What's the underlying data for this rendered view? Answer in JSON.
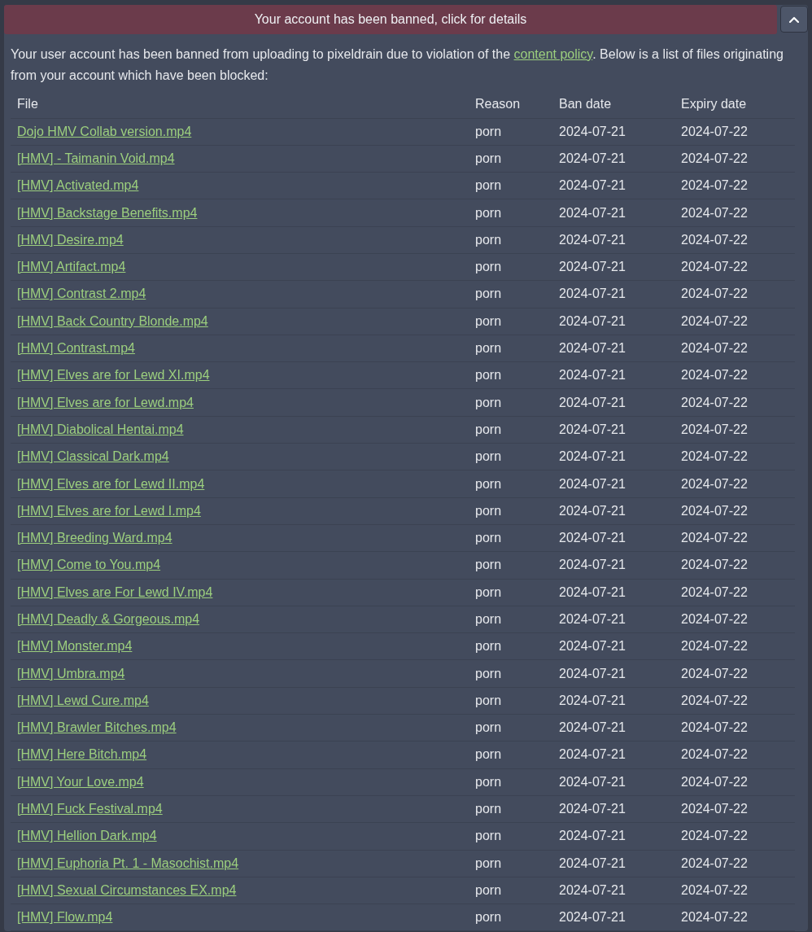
{
  "banner": {
    "text": "Your account has been banned, click for details",
    "expanded": true
  },
  "intro": {
    "before": "Your user account has been banned from uploading to pixeldrain due to violation of the ",
    "link": "content policy",
    "after": ". Below is a list of files originating from your account which have been blocked:"
  },
  "table": {
    "columns": [
      "File",
      "Reason",
      "Ban date",
      "Expiry date"
    ],
    "rows": [
      [
        "Dojo HMV Collab version.mp4",
        "porn",
        "2024-07-21",
        "2024-07-22"
      ],
      [
        "[HMV] - Taimanin Void.mp4",
        "porn",
        "2024-07-21",
        "2024-07-22"
      ],
      [
        "[HMV] Activated.mp4",
        "porn",
        "2024-07-21",
        "2024-07-22"
      ],
      [
        "[HMV] Backstage Benefits.mp4",
        "porn",
        "2024-07-21",
        "2024-07-22"
      ],
      [
        "[HMV] Desire.mp4",
        "porn",
        "2024-07-21",
        "2024-07-22"
      ],
      [
        "[HMV] Artifact.mp4",
        "porn",
        "2024-07-21",
        "2024-07-22"
      ],
      [
        "[HMV] Contrast 2.mp4",
        "porn",
        "2024-07-21",
        "2024-07-22"
      ],
      [
        "[HMV] Back Country Blonde.mp4",
        "porn",
        "2024-07-21",
        "2024-07-22"
      ],
      [
        "[HMV] Contrast.mp4",
        "porn",
        "2024-07-21",
        "2024-07-22"
      ],
      [
        "[HMV] Elves are for Lewd XI.mp4",
        "porn",
        "2024-07-21",
        "2024-07-22"
      ],
      [
        "[HMV] Elves are for Lewd.mp4",
        "porn",
        "2024-07-21",
        "2024-07-22"
      ],
      [
        "[HMV] Diabolical Hentai.mp4",
        "porn",
        "2024-07-21",
        "2024-07-22"
      ],
      [
        "[HMV] Classical Dark.mp4",
        "porn",
        "2024-07-21",
        "2024-07-22"
      ],
      [
        "[HMV] Elves are for Lewd II.mp4",
        "porn",
        "2024-07-21",
        "2024-07-22"
      ],
      [
        "[HMV] Elves are for Lewd I.mp4",
        "porn",
        "2024-07-21",
        "2024-07-22"
      ],
      [
        "[HMV] Breeding Ward.mp4",
        "porn",
        "2024-07-21",
        "2024-07-22"
      ],
      [
        "[HMV] Come to You.mp4",
        "porn",
        "2024-07-21",
        "2024-07-22"
      ],
      [
        "[HMV] Elves are For Lewd IV.mp4",
        "porn",
        "2024-07-21",
        "2024-07-22"
      ],
      [
        "[HMV] Deadly & Gorgeous.mp4",
        "porn",
        "2024-07-21",
        "2024-07-22"
      ],
      [
        "[HMV] Monster.mp4",
        "porn",
        "2024-07-21",
        "2024-07-22"
      ],
      [
        "[HMV] Umbra.mp4",
        "porn",
        "2024-07-21",
        "2024-07-22"
      ],
      [
        "[HMV] Lewd Cure.mp4",
        "porn",
        "2024-07-21",
        "2024-07-22"
      ],
      [
        "[HMV] Brawler Bitches.mp4",
        "porn",
        "2024-07-21",
        "2024-07-22"
      ],
      [
        "[HMV] Here Bitch.mp4",
        "porn",
        "2024-07-21",
        "2024-07-22"
      ],
      [
        "[HMV] Your Love.mp4",
        "porn",
        "2024-07-21",
        "2024-07-22"
      ],
      [
        "[HMV] Fuck Festival.mp4",
        "porn",
        "2024-07-21",
        "2024-07-22"
      ],
      [
        "[HMV] Hellion Dark.mp4",
        "porn",
        "2024-07-21",
        "2024-07-22"
      ],
      [
        "[HMV] Euphoria Pt. 1 - Masochist.mp4",
        "porn",
        "2024-07-21",
        "2024-07-22"
      ],
      [
        "[HMV] Sexual Circumstances EX.mp4",
        "porn",
        "2024-07-21",
        "2024-07-22"
      ],
      [
        "[HMV] Flow.mp4",
        "porn",
        "2024-07-21",
        "2024-07-22"
      ]
    ]
  }
}
